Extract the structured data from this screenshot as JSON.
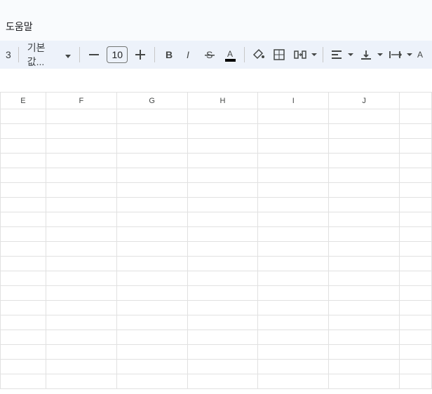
{
  "menubar": {
    "help": "도움말"
  },
  "toolbar": {
    "zoom_suffix": "3",
    "font_name": "기본값...",
    "font_size": "10",
    "text_color_underline": "#000000"
  },
  "columns": [
    "E",
    "F",
    "G",
    "H",
    "I",
    "J",
    ""
  ],
  "rows": 19
}
